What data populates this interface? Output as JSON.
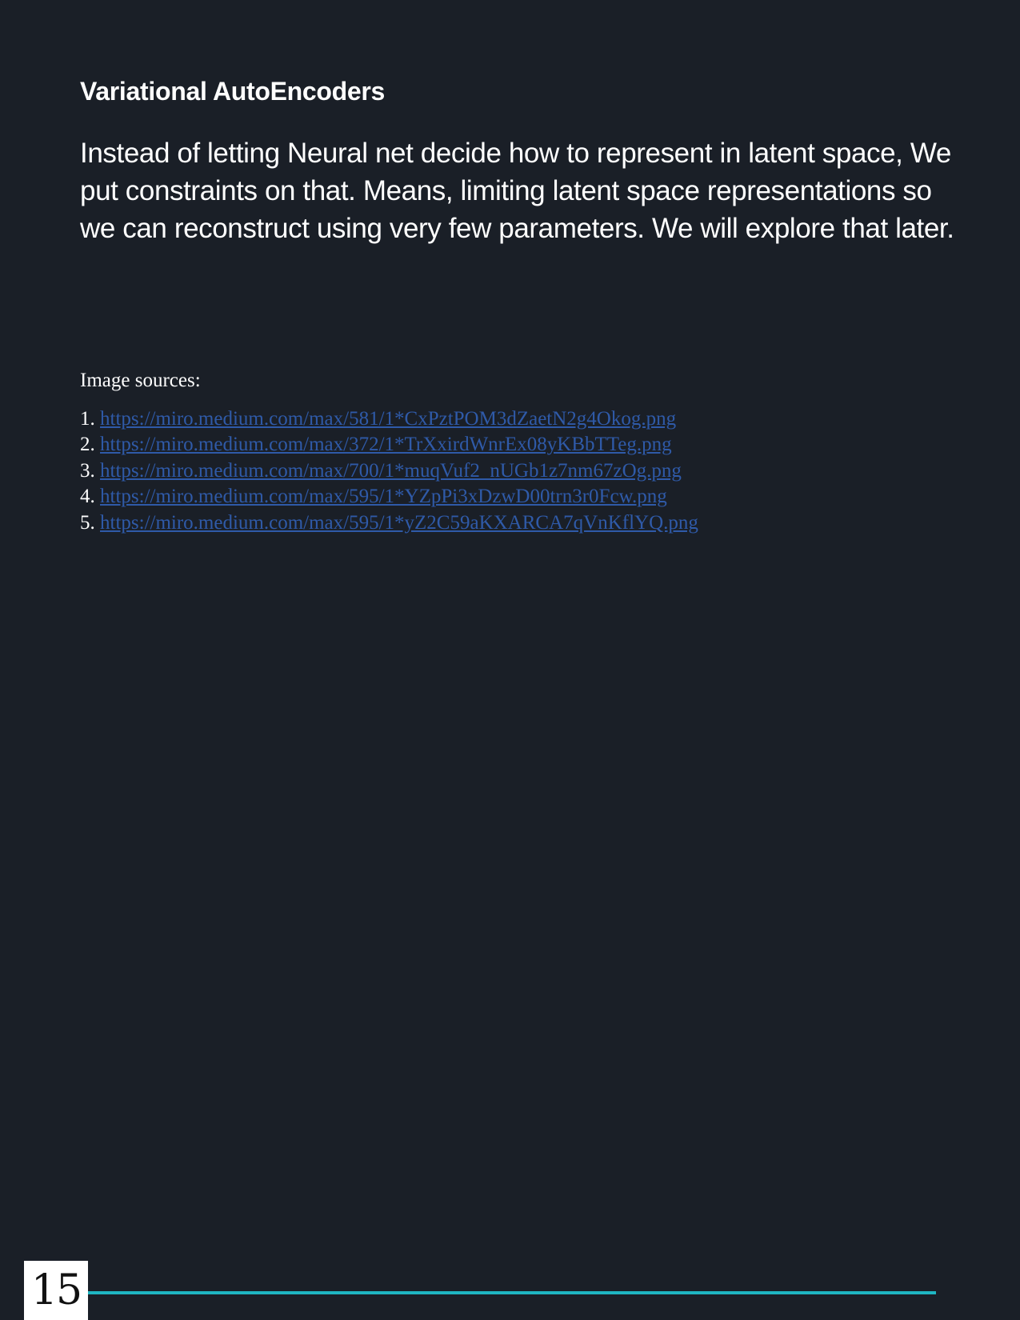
{
  "document": {
    "heading": "Variational AutoEncoders",
    "body": "Instead of letting Neural net decide how to represent in latent space, We put constraints on that. Means, limiting latent space representations so we can reconstruct using very few parameters. We will explore that later.",
    "sources_label": "Image sources:",
    "sources": [
      {
        "num": "1.",
        "url": "https://miro.medium.com/max/581/1*CxPztPOM3dZaetN2g4Okog.png"
      },
      {
        "num": "2.",
        "url": "https://miro.medium.com/max/372/1*TrXxirdWnrEx08yKBbTTeg.png"
      },
      {
        "num": "3.",
        "url": "https://miro.medium.com/max/700/1*muqVuf2_nUGb1z7nm67zOg.png"
      },
      {
        "num": "4.",
        "url": "https://miro.medium.com/max/595/1*YZpPi3xDzwD00trn3r0Fcw.png"
      },
      {
        "num": "5.",
        "url": "https://miro.medium.com/max/595/1*yZ2C59aKXARCA7qVnKflYQ.png"
      }
    ]
  },
  "footer": {
    "page_number": "15"
  },
  "colors": {
    "background": "#1a1f27",
    "link": "#2f5aa8",
    "footer_rule": "#1fb5c2"
  }
}
